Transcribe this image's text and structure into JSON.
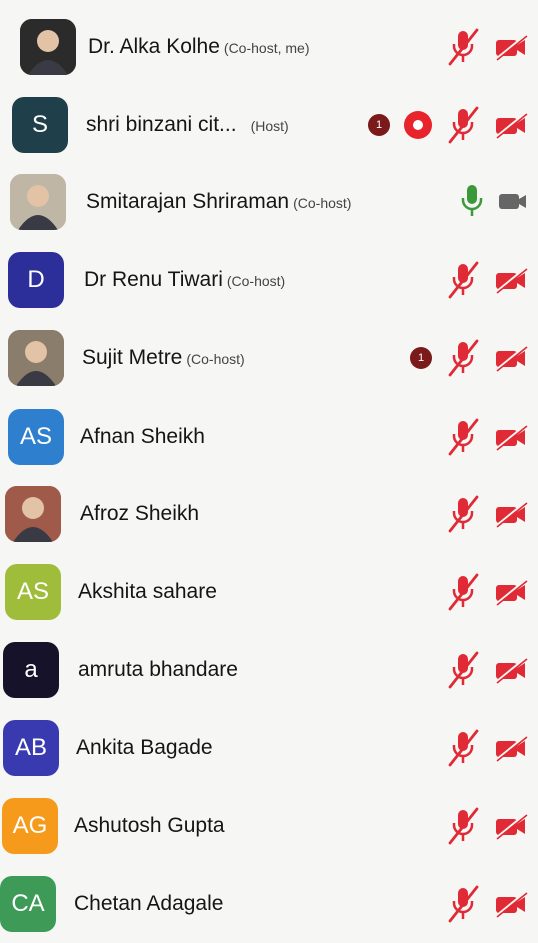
{
  "participants": [
    {
      "name": "Dr. Alka Kolhe",
      "role": "(Co-host, me)",
      "avatar_text": "",
      "avatar_color": "#2b2b2b",
      "avatar_type": "photo",
      "mic": "muted",
      "video": "off",
      "badge": "",
      "recording": false
    },
    {
      "name": "shri binzani cit...",
      "role": "(Host)",
      "avatar_text": "S",
      "avatar_color": "#1f3f4a",
      "avatar_type": "letter",
      "mic": "muted",
      "video": "off",
      "badge": "1",
      "recording": true
    },
    {
      "name": "Smitarajan Shriraman",
      "role": "(Co-host)",
      "avatar_text": "",
      "avatar_color": "#bfb6a6",
      "avatar_type": "photo",
      "mic": "on",
      "video": "on",
      "badge": "",
      "recording": false
    },
    {
      "name": "Dr Renu Tiwari",
      "role": "(Co-host)",
      "avatar_text": "D",
      "avatar_color": "#2c2f9a",
      "avatar_type": "letter",
      "mic": "muted",
      "video": "off",
      "badge": "",
      "recording": false
    },
    {
      "name": "Sujit Metre",
      "role": "(Co-host)",
      "avatar_text": "",
      "avatar_color": "#8a7d6b",
      "avatar_type": "photo",
      "mic": "muted",
      "video": "off",
      "badge": "1",
      "recording": false
    },
    {
      "name": "Afnan Sheikh",
      "role": "",
      "avatar_text": "AS",
      "avatar_color": "#2f7fcf",
      "avatar_type": "letter",
      "mic": "muted",
      "video": "off",
      "badge": "",
      "recording": false
    },
    {
      "name": "Afroz Sheikh",
      "role": "",
      "avatar_text": "",
      "avatar_color": "#a05a4a",
      "avatar_type": "photo",
      "mic": "muted",
      "video": "off",
      "badge": "",
      "recording": false
    },
    {
      "name": "Akshita sahare",
      "role": "",
      "avatar_text": "AS",
      "avatar_color": "#9fbd3a",
      "avatar_type": "letter",
      "mic": "muted",
      "video": "off",
      "badge": "",
      "recording": false
    },
    {
      "name": "amruta bhandare",
      "role": "",
      "avatar_text": "a",
      "avatar_color": "#15122a",
      "avatar_type": "letter",
      "mic": "muted",
      "video": "off",
      "badge": "",
      "recording": false
    },
    {
      "name": "Ankita Bagade",
      "role": "",
      "avatar_text": "AB",
      "avatar_color": "#3a3ab0",
      "avatar_type": "letter",
      "mic": "muted",
      "video": "off",
      "badge": "",
      "recording": false
    },
    {
      "name": "Ashutosh Gupta",
      "role": "",
      "avatar_text": "AG",
      "avatar_color": "#f59a1b",
      "avatar_type": "letter",
      "mic": "muted",
      "video": "off",
      "badge": "",
      "recording": false
    },
    {
      "name": "Chetan Adagale",
      "role": "",
      "avatar_text": "CA",
      "avatar_color": "#3d9a57",
      "avatar_type": "letter",
      "mic": "muted",
      "video": "off",
      "badge": "",
      "recording": false
    }
  ],
  "colors": {
    "muted": "#e02a35",
    "active_mic": "#3a9a3a",
    "video_on": "#666666"
  }
}
